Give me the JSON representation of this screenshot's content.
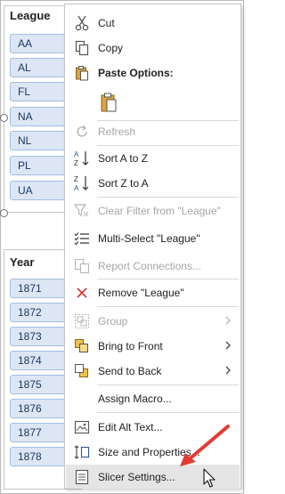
{
  "league_slicer": {
    "title": "League",
    "items": [
      "AA",
      "AL",
      "FL",
      "NA",
      "NL",
      "PL",
      "UA"
    ]
  },
  "year_slicer": {
    "title": "Year",
    "items": [
      "1871",
      "1872",
      "1873",
      "1874",
      "1875",
      "1876",
      "1877",
      "1878"
    ]
  },
  "menu": {
    "cut": "Cut",
    "copy": "Copy",
    "paste_options": "Paste Options:",
    "refresh": "Refresh",
    "sort_az": "Sort A to Z",
    "sort_za": "Sort Z to A",
    "clear_filter": "Clear Filter from \"League\"",
    "multi_select": "Multi-Select \"League\"",
    "report_connections": "Report Connections...",
    "remove": "Remove \"League\"",
    "group": "Group",
    "bring_to_front": "Bring to Front",
    "send_to_back": "Send to Back",
    "assign_macro": "Assign Macro...",
    "edit_alt_text": "Edit Alt Text...",
    "size_properties": "Size and Properties...",
    "slicer_settings": "Slicer Settings..."
  },
  "colors": {
    "accent_red": "#e23c33",
    "slicer_item_bg": "#dce6f4",
    "disabled_text": "#a6a6a6"
  }
}
